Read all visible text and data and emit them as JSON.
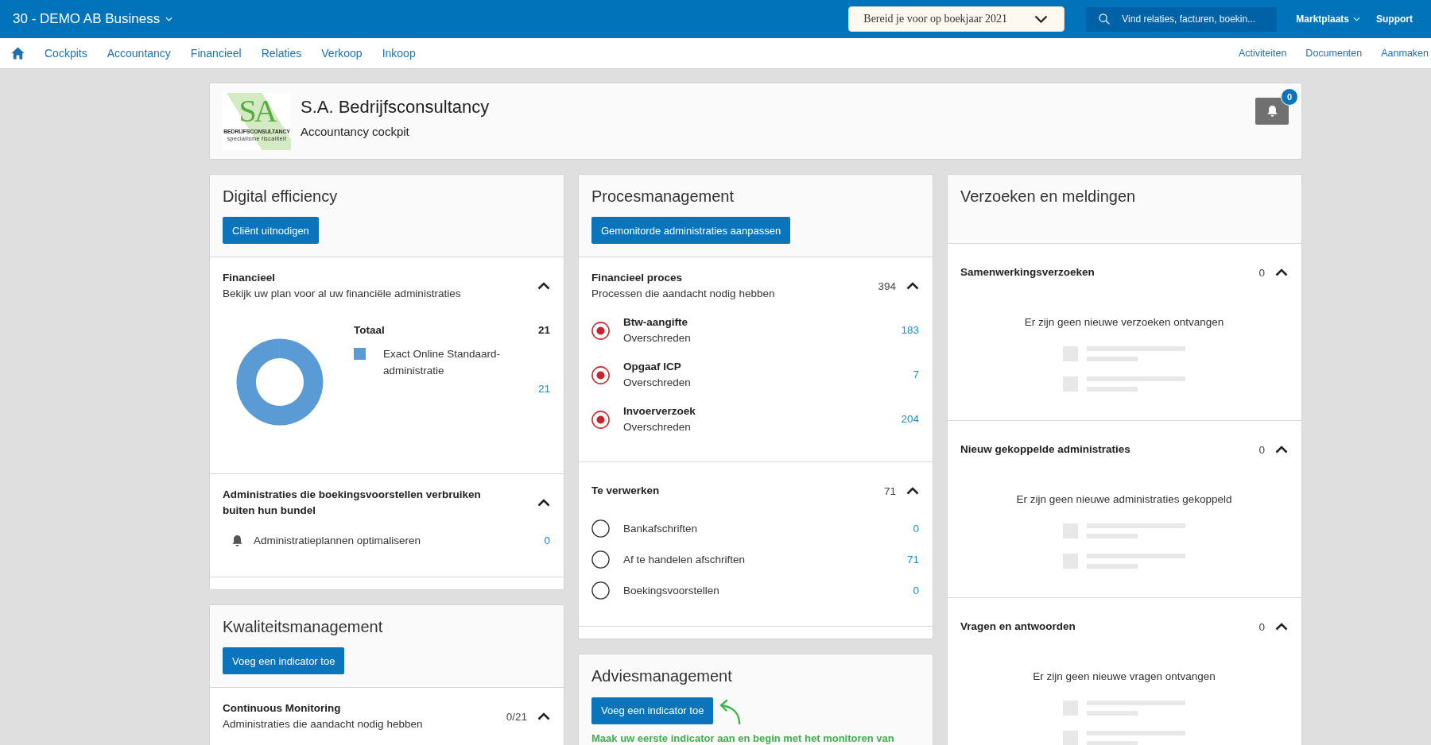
{
  "top_bar": {
    "company": "30 - DEMO AB Business",
    "company_dropdown": true,
    "year_select": "Bereid je voor op boekjaar 2021",
    "search": {
      "placeholder": "Vind relaties, facturen, boekin..."
    },
    "links": [
      {
        "label": "Marktplaats",
        "dropdown": true
      },
      {
        "label": "Support",
        "dropdown": false
      }
    ]
  },
  "nav": {
    "items": [
      "Cockpits",
      "Accountancy",
      "Financieel",
      "Relaties",
      "Verkoop",
      "Inkoop"
    ],
    "right_items": [
      "Activiteiten",
      "Documenten",
      "Aanmaken"
    ]
  },
  "header": {
    "logo": {
      "monogram": "SA",
      "name": "BEDRIJFSCONSULTANCY",
      "tagline": "specialisme fiscaliteit"
    },
    "title": "S.A. Bedrijfsconsultancy",
    "subtitle": "Accountancy cockpit",
    "notification_count": "0"
  },
  "columns": [
    {
      "cards": [
        {
          "title": "Digital efficiency",
          "button": "Cliënt uitnodigen",
          "sections": [
            {
              "kind": "chart",
              "title": "Financieel",
              "subtitle": "Bekijk uw plan voor al uw financiële administraties",
              "expanded": true,
              "total_label": "Totaal",
              "total": "21",
              "legend": [
                {
                  "label": "Exact Online Standaard-administratie",
                  "value": "21",
                  "color": "#5b9bd5"
                }
              ]
            },
            {
              "kind": "notices",
              "title": "Administraties die boekingsvoorstellen verbruiken buiten hun bundel",
              "expanded": true,
              "items": [
                {
                  "label": "Administratieplannen optimaliseren",
                  "value": "0"
                }
              ]
            }
          ]
        },
        {
          "title": "Kwaliteitsmanagement",
          "button": "Voeg een indicator toe",
          "sections": [
            {
              "kind": "tasks",
              "title": "Continuous Monitoring",
              "subtitle": "Administraties die aandacht nodig hebben",
              "count": "0/21",
              "expanded": true
            }
          ]
        }
      ]
    },
    {
      "cards": [
        {
          "title": "Procesmanagement",
          "button": "Gemonitorde administraties aanpassen",
          "sections": [
            {
              "kind": "tasks",
              "title": "Financieel proces",
              "subtitle": "Processen die aandacht nodig hebben",
              "count": "394",
              "expanded": true,
              "items": [
                {
                  "label": "Btw-aangifte",
                  "status": "Overschreden",
                  "value": "183",
                  "overdue": true
                },
                {
                  "label": "Opgaaf ICP",
                  "status": "Overschreden",
                  "value": "7",
                  "overdue": true
                },
                {
                  "label": "Invoerverzoek",
                  "status": "Overschreden",
                  "value": "204",
                  "overdue": true
                }
              ]
            },
            {
              "kind": "tasks",
              "title": "Te verwerken",
              "count": "71",
              "expanded": true,
              "items": [
                {
                  "label": "Bankafschriften",
                  "value": "0",
                  "overdue": false
                },
                {
                  "label": "Af te handelen afschriften",
                  "value": "71",
                  "overdue": false
                },
                {
                  "label": "Boekingsvoorstellen",
                  "value": "0",
                  "overdue": false
                }
              ]
            }
          ]
        },
        {
          "title": "Adviesmanagement",
          "button": "Voeg een indicator toe",
          "hint": "Maak uw eerste indicator aan en begin met het monitoren van"
        }
      ]
    },
    {
      "cards": [
        {
          "title": "Verzoeken en meldingen",
          "sections": [
            {
              "kind": "empty",
              "title": "Samenwerkingsverzoeken",
              "count": "0",
              "expanded": true,
              "message": "Er zijn geen nieuwe verzoeken ontvangen"
            },
            {
              "kind": "empty",
              "title": "Nieuw gekoppelde administraties",
              "count": "0",
              "expanded": true,
              "message": "Er zijn geen nieuwe administraties gekoppeld"
            },
            {
              "kind": "empty",
              "title": "Vragen en antwoorden",
              "count": "0",
              "expanded": true,
              "message": "Er zijn geen nieuwe vragen ontvangen"
            }
          ]
        }
      ]
    }
  ]
}
